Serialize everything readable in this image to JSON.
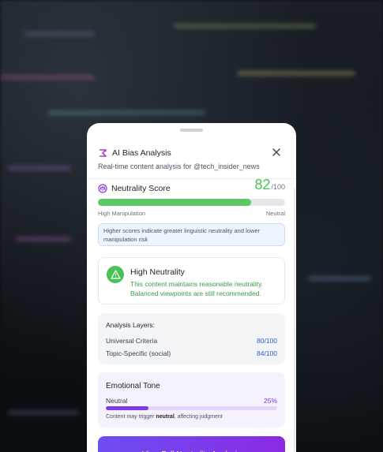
{
  "header": {
    "title": "AI Bias Analysis",
    "subtitle": "Real-time content analysis for @tech_insider_news"
  },
  "score": {
    "label": "Neutrality Score",
    "value": "82",
    "max": "/100",
    "fraction": 0.82,
    "low_label": "High Manipulation",
    "high_label": "Neutral",
    "info": "Higher scores indicate greater linguistic neutrality and lower manipulation risk"
  },
  "status": {
    "title": "High Neutrality",
    "desc_line1": "This content maintains reasonable neutrality.",
    "desc_line2": "Balanced viewpoints are still recommended."
  },
  "layers": {
    "title": "Analysis Layers:",
    "items": [
      {
        "label": "Universal Criteria",
        "value": "80/100"
      },
      {
        "label": "Topic-Specific (social)",
        "value": "84/100"
      }
    ]
  },
  "tone": {
    "title": "Emotional Tone",
    "label": "Neutral",
    "percent": "25%",
    "fraction": 0.25,
    "note_prefix": "Content may trigger ",
    "note_bold": "neutral",
    "note_suffix": ", affecting judgment"
  },
  "cta": {
    "label": "View Full Neutrality Analysis"
  },
  "colors": {
    "accent_green": "#4cc058",
    "accent_purple": "#7c3aed",
    "accent_blue": "#2f5bd0"
  },
  "icons": {
    "logo": "sparkle-logo-icon",
    "close": "close-icon",
    "score": "scale-icon",
    "status": "warning-triangle-icon"
  }
}
